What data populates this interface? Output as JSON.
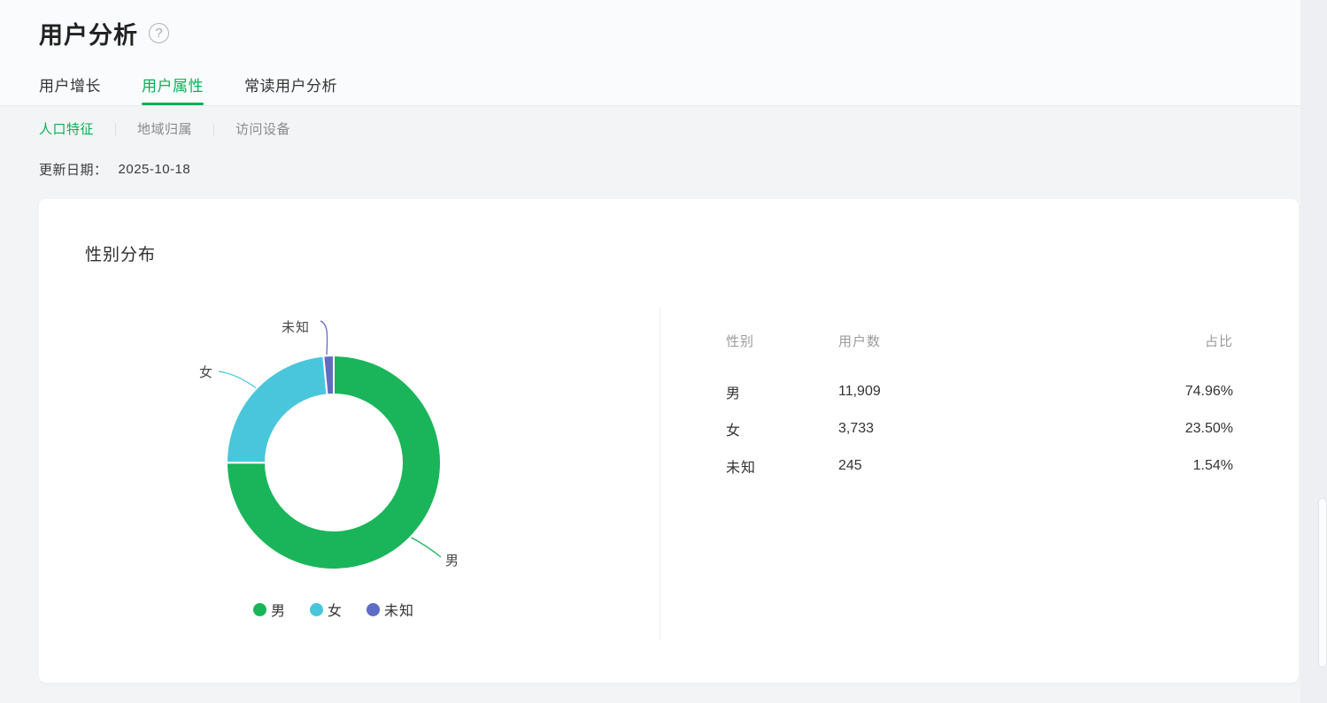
{
  "page": {
    "title": "用户分析",
    "help_glyph": "?"
  },
  "tabs": [
    {
      "label": "用户增长",
      "active": false
    },
    {
      "label": "用户属性",
      "active": true
    },
    {
      "label": "常读用户分析",
      "active": false
    }
  ],
  "subtabs": [
    {
      "label": "人口特征",
      "active": true
    },
    {
      "label": "地域归属",
      "active": false
    },
    {
      "label": "访问设备",
      "active": false
    }
  ],
  "update": {
    "label": "更新日期：",
    "date": "2025-10-18"
  },
  "card": {
    "title": "性别分布"
  },
  "chart_data": {
    "type": "pie",
    "title": "性别分布",
    "donut": true,
    "start_angle": "top",
    "direction": "clockwise",
    "inner_radius_ratio": 0.64,
    "categories": [
      "男",
      "女",
      "未知"
    ],
    "values": [
      11909,
      3733,
      245
    ],
    "percentages": [
      74.96,
      23.5,
      1.54
    ],
    "colors": [
      "#1ab55a",
      "#4ac6dc",
      "#5f6cc6"
    ],
    "legend_position": "bottom",
    "legend": [
      "男",
      "女",
      "未知"
    ]
  },
  "table": {
    "headers": [
      "性别",
      "用户数",
      "占比"
    ],
    "rows": [
      {
        "gender": "男",
        "users": "11,909",
        "ratio": "74.96%"
      },
      {
        "gender": "女",
        "users": "3,733",
        "ratio": "23.50%"
      },
      {
        "gender": "未知",
        "users": "245",
        "ratio": "1.54%"
      }
    ]
  },
  "colors": {
    "accent": "#0ab157",
    "page_bg": "#f3f4f6",
    "header_bg": "#fafbfc",
    "card_bg": "#ffffff"
  }
}
